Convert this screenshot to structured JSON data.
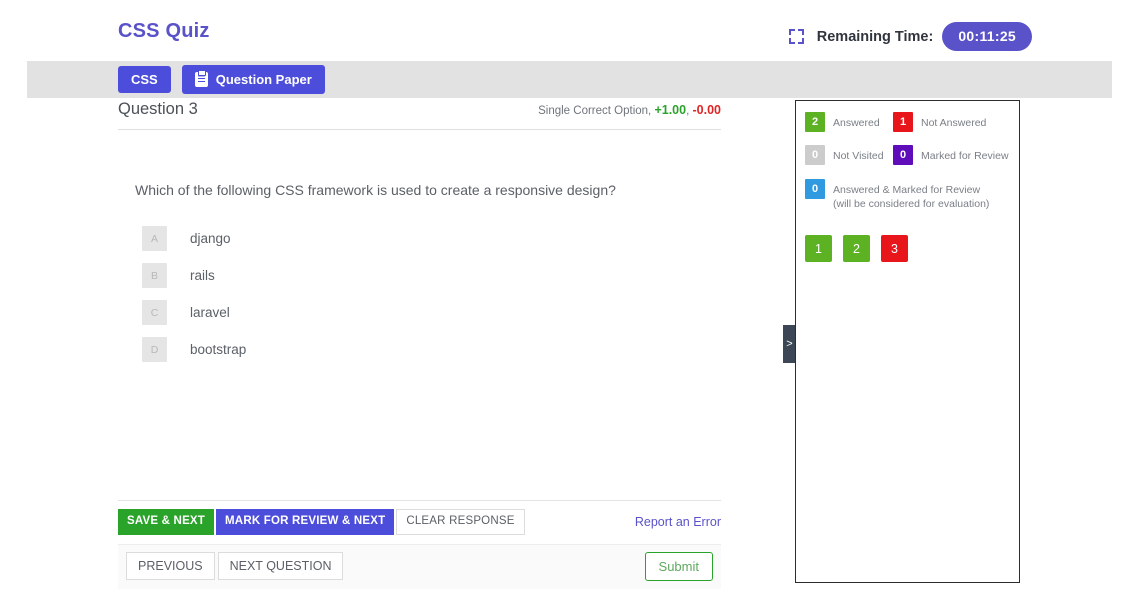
{
  "header": {
    "brand_title": "CSS Quiz",
    "fullscreen_icon": "fullscreen-icon",
    "timer_label": "Remaining Time:",
    "timer_value": "00:11:25",
    "accent_color": "#5a52c8"
  },
  "tabs": [
    {
      "label": "CSS",
      "icon": ""
    },
    {
      "label": "Question Paper",
      "icon": "clipboard-icon"
    }
  ],
  "question": {
    "title": "Question 3",
    "meta_type": "Single Correct Option,",
    "meta_positive": "+1.00",
    "meta_comma": ",",
    "meta_negative": "-0.00",
    "text": "Which of the following CSS framework is used to create a responsive design?",
    "options": [
      {
        "key": "A",
        "label": "django"
      },
      {
        "key": "B",
        "label": "rails"
      },
      {
        "key": "C",
        "label": "laravel"
      },
      {
        "key": "D",
        "label": "bootstrap"
      }
    ]
  },
  "actions": {
    "save_next": "SAVE & NEXT",
    "mark_review_next": "MARK FOR REVIEW & NEXT",
    "clear_response": "CLEAR RESPONSE",
    "report_error": "Report an Error",
    "previous": "PREVIOUS",
    "next_question": "NEXT QUESTION",
    "submit": "Submit"
  },
  "sidebar": {
    "toggle_icon": ">",
    "legend": [
      {
        "count": "2",
        "label": "Answered",
        "color": "#5cb223"
      },
      {
        "count": "1",
        "label": "Not Answered",
        "color": "#e8161a"
      },
      {
        "count": "0",
        "label": "Not Visited",
        "color": "#cccccc"
      },
      {
        "count": "0",
        "label": "Marked for Review",
        "color": "#5f0dbb"
      }
    ],
    "legend_full": {
      "count": "0",
      "label": "Answered & Marked for Review (will be considered for evaluation)",
      "color": "#2f9ae0"
    },
    "palette": [
      {
        "number": "1",
        "color": "#5cb223"
      },
      {
        "number": "2",
        "color": "#5cb223"
      },
      {
        "number": "3",
        "color": "#e8161a"
      }
    ]
  }
}
